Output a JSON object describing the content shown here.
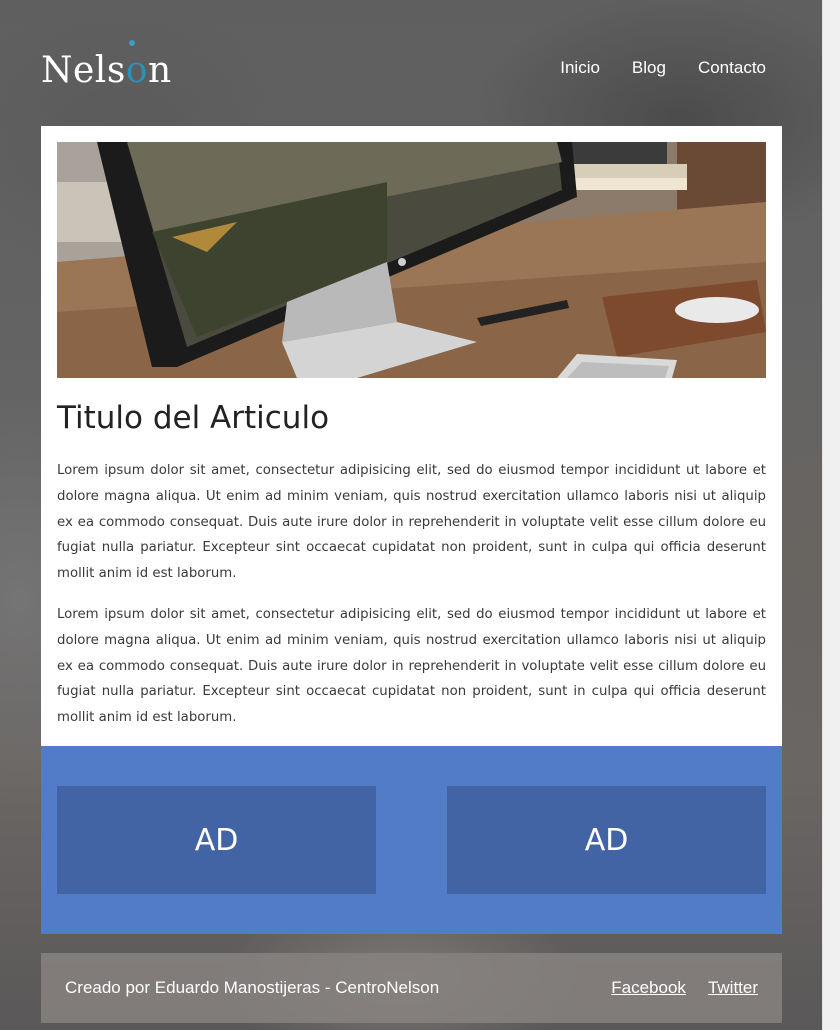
{
  "site": {
    "logo_text_prefix": "Nels",
    "logo_text_o": "o",
    "logo_text_suffix": "n"
  },
  "nav": {
    "items": [
      {
        "label": "Inicio"
      },
      {
        "label": "Blog"
      },
      {
        "label": "Contacto"
      }
    ]
  },
  "article": {
    "hero_image": "desk-computer-photo",
    "title": "Titulo del Articulo",
    "paragraphs": [
      "Lorem ipsum dolor sit amet, consectetur adipisicing elit, sed do eiusmod tempor incididunt ut labore et dolore magna aliqua. Ut enim ad minim veniam, quis nostrud exercitation ullamco laboris nisi ut aliquip ex ea commodo consequat. Duis aute irure dolor in reprehenderit in voluptate velit esse cillum dolore eu fugiat nulla pariatur. Excepteur sint occaecat cupidatat non proident, sunt in culpa qui officia deserunt mollit anim id est laborum.",
      "Lorem ipsum dolor sit amet, consectetur adipisicing elit, sed do eiusmod tempor incididunt ut labore et dolore magna aliqua. Ut enim ad minim veniam, quis nostrud exercitation ullamco laboris nisi ut aliquip ex ea commodo consequat. Duis aute irure dolor in reprehenderit in voluptate velit esse cillum dolore eu fugiat nulla pariatur. Excepteur sint occaecat cupidatat non proident, sunt in culpa qui officia deserunt mollit anim id est laborum."
    ]
  },
  "ads": {
    "left_label": "AD",
    "right_label": "AD"
  },
  "footer": {
    "credit": "Creado por Eduardo Manostijeras - CentroNelson",
    "links": [
      {
        "label": "Facebook"
      },
      {
        "label": "Twitter"
      }
    ]
  },
  "colors": {
    "ads_background": "#527bc8",
    "ad_box": "#4264a5",
    "logo_accent": "#2a90b8"
  }
}
